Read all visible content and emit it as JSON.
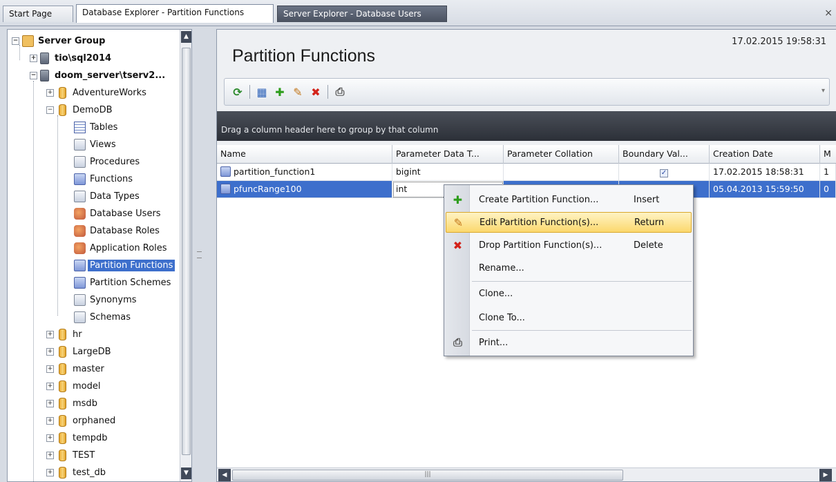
{
  "tabs": [
    {
      "label": "Start Page"
    },
    {
      "label": "Database Explorer - Partition Functions"
    },
    {
      "label": "Server Explorer - Database Users"
    }
  ],
  "close_glyph": "×",
  "tree": {
    "server_group": "Server Group",
    "server1": "tio\\sql2014",
    "server2": "doom_server\\tserv2...",
    "db_adventureworks": "AdventureWorks",
    "db_demodb": "DemoDB",
    "nodes": [
      {
        "label": "Tables",
        "icon": "table-icon"
      },
      {
        "label": "Views",
        "icon": "view-icon"
      },
      {
        "label": "Procedures",
        "icon": "procedure-icon"
      },
      {
        "label": "Functions",
        "icon": "function-icon"
      },
      {
        "label": "Data Types",
        "icon": "data-type-icon"
      },
      {
        "label": "Database Users",
        "icon": "users-icon"
      },
      {
        "label": "Database Roles",
        "icon": "roles-icon"
      },
      {
        "label": "Application Roles",
        "icon": "app-roles-icon"
      },
      {
        "label": "Partition Functions",
        "icon": "partition-function-icon"
      },
      {
        "label": "Partition Schemes",
        "icon": "partition-scheme-icon"
      },
      {
        "label": "Synonyms",
        "icon": "synonym-icon"
      },
      {
        "label": "Schemas",
        "icon": "schema-icon"
      }
    ],
    "other_dbs": [
      "hr",
      "LargeDB",
      "master",
      "model",
      "msdb",
      "orphaned",
      "tempdb",
      "TEST",
      "test_db"
    ]
  },
  "main": {
    "title": "Partition Functions",
    "timestamp": "17.02.2015 19:58:31",
    "group_hint": "Drag a column header here to group by that column",
    "columns": [
      "Name",
      "Parameter Data T...",
      "Parameter Collation",
      "Boundary Val...",
      "Creation Date",
      "M"
    ],
    "rows": [
      {
        "name": "partition_function1",
        "type": "bigint",
        "collation": "",
        "boundary_checked": true,
        "created": "17.02.2015 18:58:31",
        "m": "1"
      },
      {
        "name": "pfuncRange100",
        "type": "int",
        "collation": "",
        "boundary_checked": false,
        "created": "05.04.2013 15:59:50",
        "m": "0"
      }
    ],
    "check_glyph": "✓"
  },
  "context_menu": {
    "items": [
      {
        "label": "Create Partition Function...",
        "shortcut": "Insert"
      },
      {
        "label": "Edit Partition Function(s)...",
        "shortcut": "Return"
      },
      {
        "label": "Drop Partition Function(s)...",
        "shortcut": "Delete"
      },
      {
        "label": "Rename...",
        "shortcut": ""
      },
      {
        "label": "Clone...",
        "shortcut": ""
      },
      {
        "label": "Clone To...",
        "shortcut": ""
      },
      {
        "label": "Print...",
        "shortcut": ""
      }
    ]
  },
  "glyphs": {
    "expand_plus": "+",
    "expand_minus": "−",
    "scroll_up": "▲",
    "scroll_down": "▼",
    "scroll_left": "◀",
    "scroll_right": "▶",
    "grip": "|||",
    "chevron": "▾",
    "add": "✚",
    "delete": "✖",
    "edit": "✎",
    "refresh": "⟳",
    "print": "⎙",
    "properties": "▦"
  },
  "colors": {
    "selection": "#3d6fcc",
    "menu_highlight": "#fbd86d",
    "add_green": "#2e9d1c",
    "delete_red": "#d3231a"
  }
}
